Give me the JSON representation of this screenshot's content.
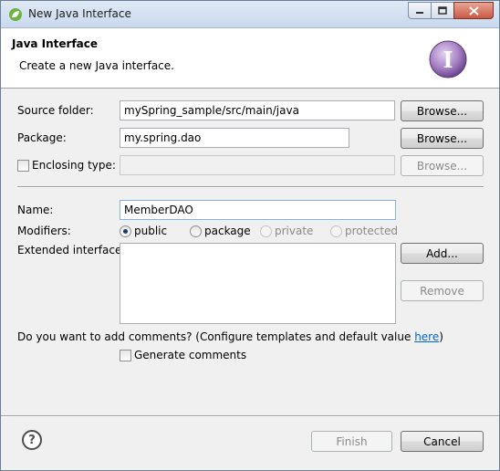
{
  "window": {
    "title": "New Java Interface"
  },
  "banner": {
    "title": "Java Interface",
    "description": "Create a new Java interface.",
    "icon": "interface-wizard-icon"
  },
  "form": {
    "source_folder": {
      "label": "Source folder:",
      "value": "mySpring_sample/src/main/java",
      "browse_label": "Browse..."
    },
    "package": {
      "label": "Package:",
      "value": "my.spring.dao",
      "browse_label": "Browse..."
    },
    "enclosing_type": {
      "label": "Enclosing type:",
      "value": "",
      "checked": false,
      "browse_label": "Browse..."
    },
    "name": {
      "label": "Name:",
      "value": "MemberDAO"
    },
    "modifiers": {
      "label": "Modifiers:",
      "options": [
        {
          "label": "public",
          "selected": true,
          "enabled": true
        },
        {
          "label": "package",
          "selected": false,
          "enabled": true
        },
        {
          "label": "private",
          "selected": false,
          "enabled": false
        },
        {
          "label": "protected",
          "selected": false,
          "enabled": false
        }
      ]
    },
    "extended_interfaces": {
      "label": "Extended interfaces:",
      "items": [],
      "add_label": "Add...",
      "remove_label": "Remove"
    },
    "comments": {
      "question": "Do you want to add comments? (Configure templates and default value ",
      "link": "here",
      "question_end": ")",
      "generate_label": "Generate comments",
      "generate_checked": false
    }
  },
  "footer": {
    "finish_label": "Finish",
    "cancel_label": "Cancel"
  }
}
